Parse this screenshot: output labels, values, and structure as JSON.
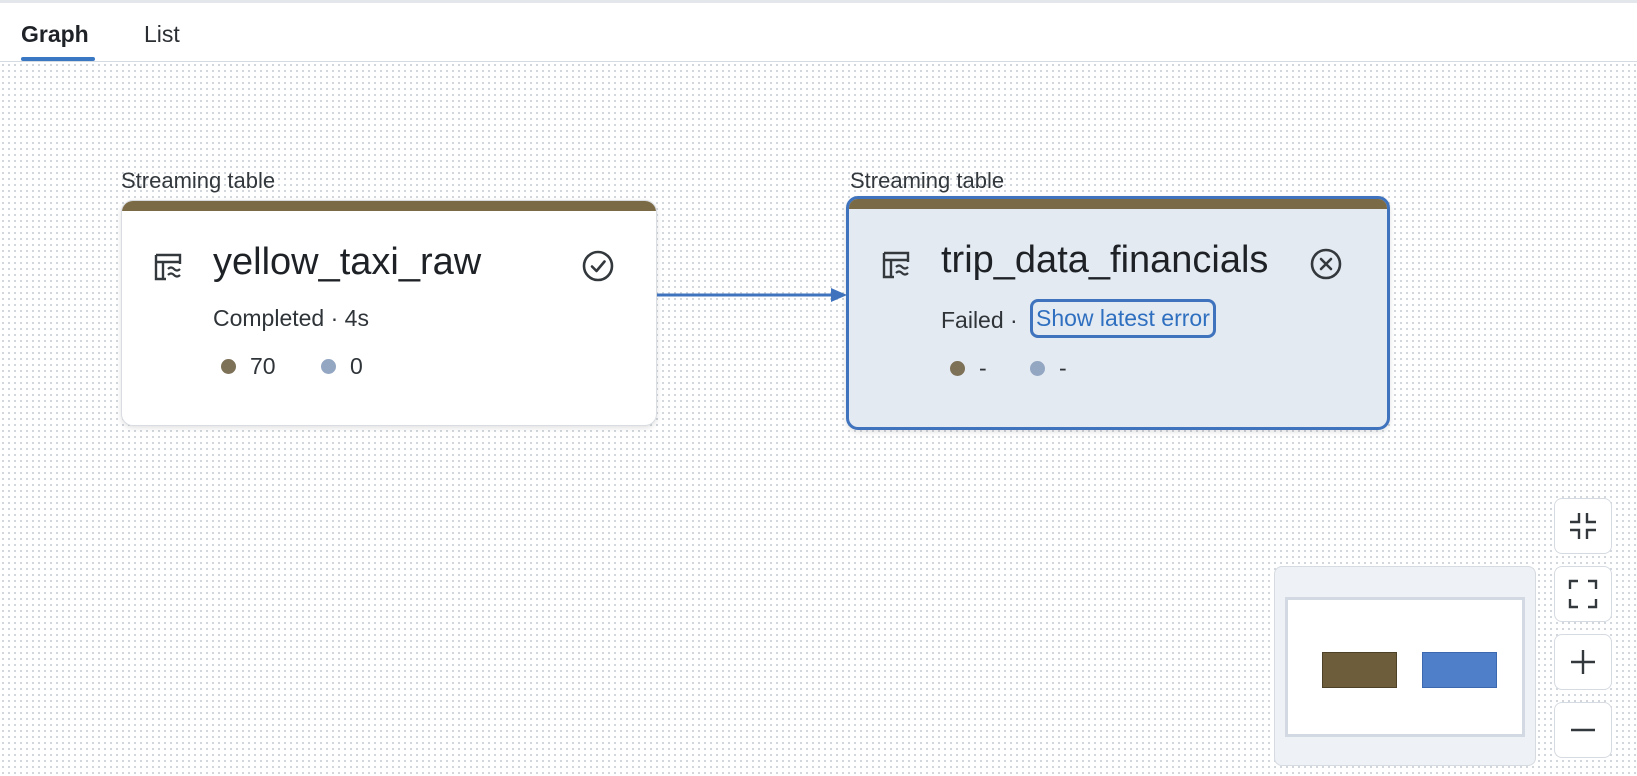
{
  "tabs": [
    {
      "label": "Graph",
      "active": true
    },
    {
      "label": "List",
      "active": false
    }
  ],
  "nodes": [
    {
      "caption": "Streaming table",
      "title": "yellow_taxi_raw",
      "icon": "streaming-table-icon",
      "status_icon": "check-circle-icon",
      "status_text": "Completed · 4s",
      "metrics": [
        {
          "icon": "dot-brown",
          "value": "70"
        },
        {
          "icon": "dot-blue",
          "value": "0"
        }
      ]
    },
    {
      "caption": "Streaming table",
      "title": "trip_data_financials",
      "icon": "streaming-table-icon",
      "status_icon": "x-circle-icon",
      "status_text": "Failed ·",
      "error_link": "Show latest error",
      "metrics": [
        {
          "icon": "dot-brown",
          "value": "-"
        },
        {
          "icon": "dot-blue",
          "value": "-"
        }
      ],
      "selected": true
    }
  ],
  "controls": [
    "collapse-icon",
    "fit-view-icon",
    "zoom-in-icon",
    "zoom-out-icon"
  ],
  "colors": {
    "accent": "#3f73bd",
    "node_bar": "#7b6a46",
    "minimap_node_1": "#6e5d3a",
    "minimap_node_2": "#4f7fc8"
  }
}
